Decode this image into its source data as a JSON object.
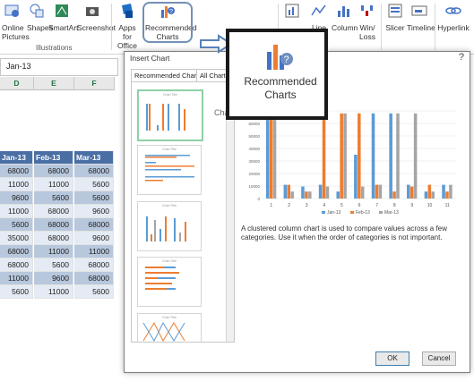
{
  "ribbon": {
    "online_pictures": "Online Pictures",
    "shapes": "Shapes",
    "smartart": "SmartArt",
    "screenshot": "Screenshot",
    "group_illustrations": "Illustrations",
    "apps_for_office": "Apps for Office",
    "recommended_charts": "Recommended Charts",
    "line": "Line",
    "column": "Column",
    "winloss": "Win/ Loss",
    "slicer": "Slicer",
    "timeline": "Timeline",
    "hyperlink": "Hyperlink"
  },
  "namebox": {
    "value": "Jan-13"
  },
  "sheet": {
    "columns": [
      "D",
      "E",
      "F"
    ],
    "headers": [
      "Jan-13",
      "Feb-13",
      "Mar-13"
    ],
    "rows": [
      [
        "68000",
        "68000",
        "68000"
      ],
      [
        "11000",
        "11000",
        "5600"
      ],
      [
        "9600",
        "5600",
        "5600"
      ],
      [
        "11000",
        "68000",
        "9600"
      ],
      [
        "5600",
        "68000",
        "68000"
      ],
      [
        "35000",
        "68000",
        "9600"
      ],
      [
        "68000",
        "11000",
        "11000"
      ],
      [
        "68000",
        "5600",
        "68000"
      ],
      [
        "11000",
        "9600",
        "68000"
      ],
      [
        "5600",
        "11000",
        "5600"
      ]
    ]
  },
  "dialog": {
    "title": "Insert Chart",
    "close": "?",
    "tab_recommended": "Recommended Charts",
    "tab_all": "All Charts",
    "thumb_title": "Chart Title",
    "preview_title": "Chart Title",
    "description": "A clustered column chart is used to compare values across a few categories. Use it when the order of categories is not important.",
    "ok": "OK",
    "cancel": "Cancel"
  },
  "callout": {
    "label": "Recommended Charts"
  },
  "chart_data": {
    "type": "bar",
    "title": "Chart Title",
    "categories": [
      "1",
      "2",
      "3",
      "4",
      "5",
      "6",
      "7",
      "8",
      "9",
      "10",
      "11"
    ],
    "series": [
      {
        "name": "Jan-13",
        "color": "#5b9bd5",
        "values": [
          68000,
          11000,
          9600,
          11000,
          5600,
          35000,
          68000,
          68000,
          11000,
          5600,
          11000
        ]
      },
      {
        "name": "Feb-13",
        "color": "#ed7d31",
        "values": [
          68000,
          11000,
          5600,
          68000,
          68000,
          68000,
          11000,
          5600,
          9600,
          11000,
          5600
        ]
      },
      {
        "name": "Mar-13",
        "color": "#a5a5a5",
        "values": [
          68000,
          5600,
          5600,
          9600,
          68000,
          9600,
          11000,
          68000,
          68000,
          5600,
          11000
        ]
      }
    ],
    "yticks": [
      "0",
      "10000",
      "20000",
      "30000",
      "40000",
      "50000",
      "60000",
      "70000"
    ],
    "ylim": [
      0,
      70000
    ],
    "legend": "bottom"
  },
  "colors": {
    "accent": "#217346",
    "table_header": "#4a6fa5",
    "callout_border": "#7390b6"
  }
}
